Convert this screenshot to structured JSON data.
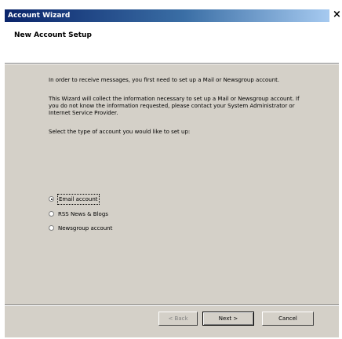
{
  "window": {
    "title": "Account Wizard",
    "close_glyph": "×"
  },
  "header": {
    "title": "New Account Setup"
  },
  "content": {
    "paragraph1": "In order to receive messages, you first need to set up a Mail or Newsgroup account.",
    "paragraph2": "This Wizard will collect the information necessary to set up a Mail or Newsgroup account. If you do not know the information requested, please contact your System Administrator or Internet Service Provider.",
    "paragraph3": "Select the type of account you would like to set up:"
  },
  "account_types": {
    "selected": "Email account",
    "options": [
      {
        "label": "Email account",
        "checked": true
      },
      {
        "label": "RSS News & Blogs",
        "checked": false
      },
      {
        "label": "Newsgroup account",
        "checked": false
      }
    ]
  },
  "buttons": {
    "back": "< Back",
    "next": "Next >",
    "cancel": "Cancel"
  },
  "icons": {
    "close": "close-icon",
    "radio": "radio-icon"
  }
}
